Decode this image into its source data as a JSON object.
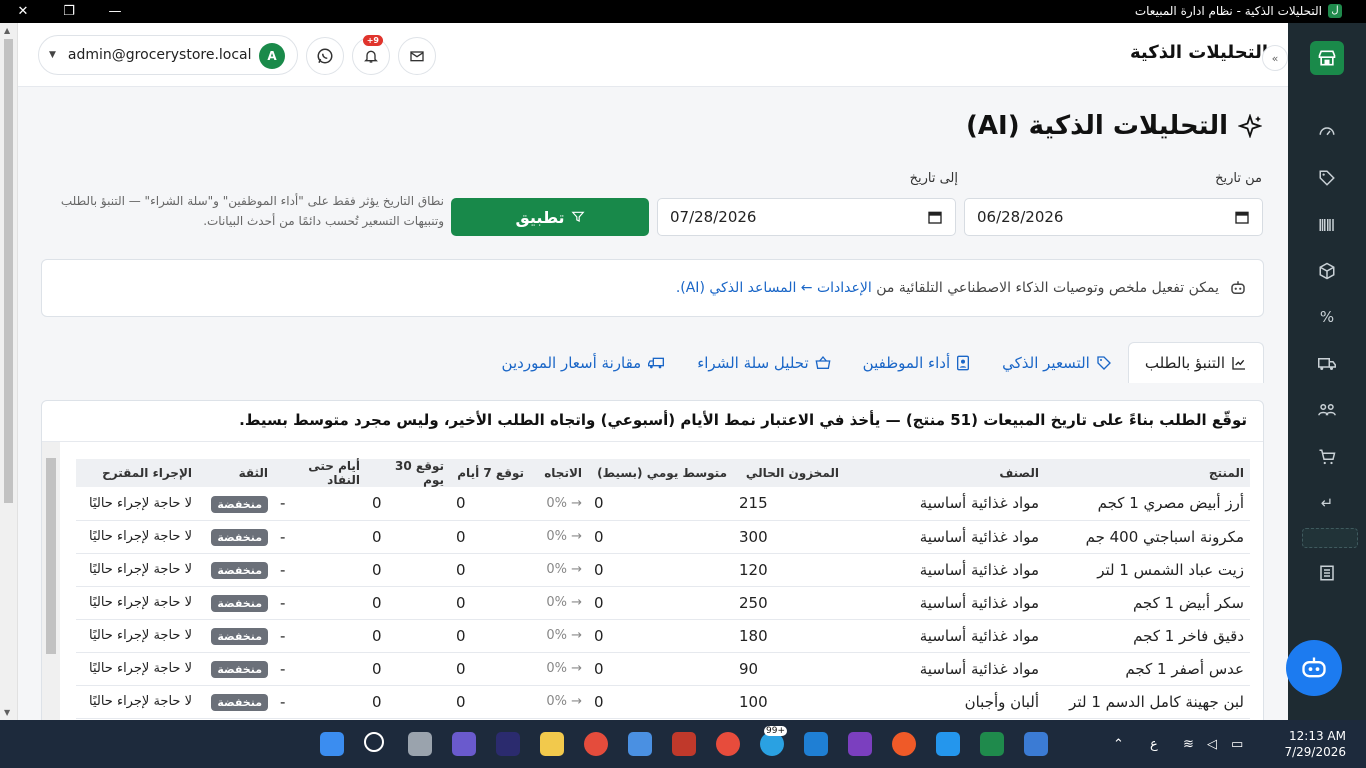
{
  "window": {
    "title": "التحليلات الذكية - نظام ادارة المبيعات",
    "app_icon_letter": "ل"
  },
  "header": {
    "title": "التحليلات الذكية",
    "user_email": "admin@grocerystore.local",
    "avatar_letter": "A",
    "notification_count": "+9"
  },
  "page": {
    "title": "التحليلات الذكية (AI)",
    "from_label": "من تاريخ",
    "to_label": "إلى تاريخ",
    "from_date": "06/28/2026",
    "to_date": "07/28/2026",
    "apply_label": "تطبيق",
    "note": "نطاق التاريخ يؤثر فقط على \"أداء الموظفين\" و\"سلة الشراء\" — التنبؤ بالطلب وتنبيهات التسعير تُحسب دائمًا من أحدث البيانات.",
    "info_text": "يمكن تفعيل ملخص وتوصيات الذكاء الاصطناعي التلقائية من",
    "info_link": "الإعدادات ← المساعد الذكي (AI)."
  },
  "tabs": [
    {
      "label": "التنبؤ بالطلب",
      "icon": "chart-line-icon",
      "active": true
    },
    {
      "label": "التسعير الذكي",
      "icon": "tag-icon",
      "active": false
    },
    {
      "label": "أداء الموظفين",
      "icon": "id-badge-icon",
      "active": false
    },
    {
      "label": "تحليل سلة الشراء",
      "icon": "basket-icon",
      "active": false
    },
    {
      "label": "مقارنة أسعار الموردين",
      "icon": "truck-icon",
      "active": false
    }
  ],
  "forecast": {
    "title": "توقّع الطلب بناءً على تاريخ المبيعات (51 منتج) — يأخذ في الاعتبار نمط الأيام (أسبوعي) واتجاه الطلب الأخير، وليس مجرد متوسط بسيط.",
    "columns": [
      "المنتج",
      "الصنف",
      "المخزون الحالي",
      "متوسط يومي (بسيط)",
      "الاتجاه",
      "توقع 7 أيام",
      "توقع 30 يوم",
      "أيام حتى النفاد",
      "الثقة",
      "الإجراء المقترح"
    ],
    "rows": [
      {
        "product": "أرز أبيض مصري 1 كجم",
        "category": "مواد غذائية أساسية",
        "stock": "215",
        "avg": "0",
        "trend": "0%",
        "f7": "0",
        "f30": "0",
        "days": "-",
        "confidence": "منخفضة",
        "action": "لا حاجة لإجراء حاليًا"
      },
      {
        "product": "مكرونة اسباجتي 400 جم",
        "category": "مواد غذائية أساسية",
        "stock": "300",
        "avg": "0",
        "trend": "0%",
        "f7": "0",
        "f30": "0",
        "days": "-",
        "confidence": "منخفضة",
        "action": "لا حاجة لإجراء حاليًا"
      },
      {
        "product": "زيت عباد الشمس 1 لتر",
        "category": "مواد غذائية أساسية",
        "stock": "120",
        "avg": "0",
        "trend": "0%",
        "f7": "0",
        "f30": "0",
        "days": "-",
        "confidence": "منخفضة",
        "action": "لا حاجة لإجراء حاليًا"
      },
      {
        "product": "سكر أبيض 1 كجم",
        "category": "مواد غذائية أساسية",
        "stock": "250",
        "avg": "0",
        "trend": "0%",
        "f7": "0",
        "f30": "0",
        "days": "-",
        "confidence": "منخفضة",
        "action": "لا حاجة لإجراء حاليًا"
      },
      {
        "product": "دقيق فاخر 1 كجم",
        "category": "مواد غذائية أساسية",
        "stock": "180",
        "avg": "0",
        "trend": "0%",
        "f7": "0",
        "f30": "0",
        "days": "-",
        "confidence": "منخفضة",
        "action": "لا حاجة لإجراء حاليًا"
      },
      {
        "product": "عدس أصفر 1 كجم",
        "category": "مواد غذائية أساسية",
        "stock": "90",
        "avg": "0",
        "trend": "0%",
        "f7": "0",
        "f30": "0",
        "days": "-",
        "confidence": "منخفضة",
        "action": "لا حاجة لإجراء حاليًا"
      },
      {
        "product": "لبن جهينة كامل الدسم 1 لتر",
        "category": "ألبان وأجبان",
        "stock": "100",
        "avg": "0",
        "trend": "0%",
        "f7": "0",
        "f30": "0",
        "days": "-",
        "confidence": "منخفضة",
        "action": "لا حاجة لإجراء حاليًا"
      }
    ]
  },
  "taskbar": {
    "time": "12:13 AM",
    "date": "7/29/2026",
    "lang": "ع",
    "badge": "99+"
  },
  "colors": {
    "primary": "#18894a",
    "sidebar": "#1e2b32",
    "link": "#1a66c7",
    "bot": "#1c7bf0"
  }
}
